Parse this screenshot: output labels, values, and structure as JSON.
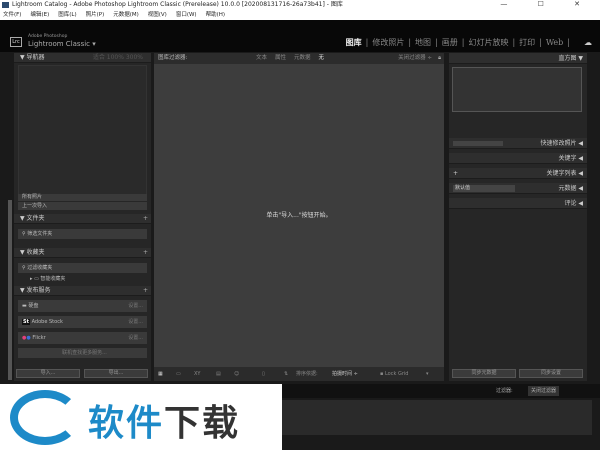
{
  "window": {
    "title": "Lightroom Catalog - Adobe Photoshop Lightroom Classic (Prerelease)  10.0.0 [202008131716-26a73b41] - 图库",
    "controls": "— ☐ ✕"
  },
  "menu": [
    "文件(F)",
    "编辑(E)",
    "图库(L)",
    "照片(P)",
    "元数据(M)",
    "视图(V)",
    "窗口(W)",
    "帮助(H)"
  ],
  "brand": {
    "logo": "Lrc",
    "line1": "Adobe Photoshop",
    "line2": "Lightroom Classic ▾"
  },
  "modules": [
    "图库",
    "修改照片",
    "地图",
    "画册",
    "幻灯片放映",
    "打印",
    "Web"
  ],
  "active_module": "图库",
  "left": {
    "navigator": {
      "title": "导航器",
      "zoom": "适合  100%  300%"
    },
    "catalog_rows": [
      "所有照片",
      "上一次导入"
    ],
    "folders": {
      "title": "文件夹",
      "filter": "筛选文件夹"
    },
    "collections": {
      "title": "收藏夹",
      "filter": "过滤收藏夹",
      "item": "智能收藏夹"
    },
    "publish": {
      "title": "发布服务",
      "services": [
        {
          "name": "硬盘",
          "setup": "设置..."
        },
        {
          "name": "Adobe Stock",
          "setup": "设置..."
        },
        {
          "name": "Flickr",
          "setup": "设置..."
        }
      ],
      "find_more": "联机查找更多服务..."
    },
    "import": "导入...",
    "export": "导出..."
  },
  "filter": {
    "label": "图库过滤器:",
    "options": [
      "文本",
      "属性",
      "元数据",
      "无"
    ],
    "active": "无",
    "close": "关闭过滤器 ÷"
  },
  "center": {
    "hint": "单击\"导入...\"按钮开始。"
  },
  "toolbar": {
    "sort_label": "排序依据:",
    "sort_value": "拍摄时间 ÷",
    "lock": "Lock Grid"
  },
  "right": {
    "histogram": "直方图 ▼",
    "quick": "快速修改照片 ◀",
    "keywords": "关键字 ◀",
    "keyword_list": "关键字列表 ◀",
    "metadata": "元数据 ◀",
    "metadata_preset": "默认值",
    "comments": "评论 ◀",
    "sync_meta": "同步元数据",
    "sync_settings": "同步设置"
  },
  "filmstrip": {
    "filter_label": "过滤器:",
    "filter_value": "关闭过滤器"
  },
  "watermark": {
    "text1": "软件",
    "text2": "下载"
  }
}
